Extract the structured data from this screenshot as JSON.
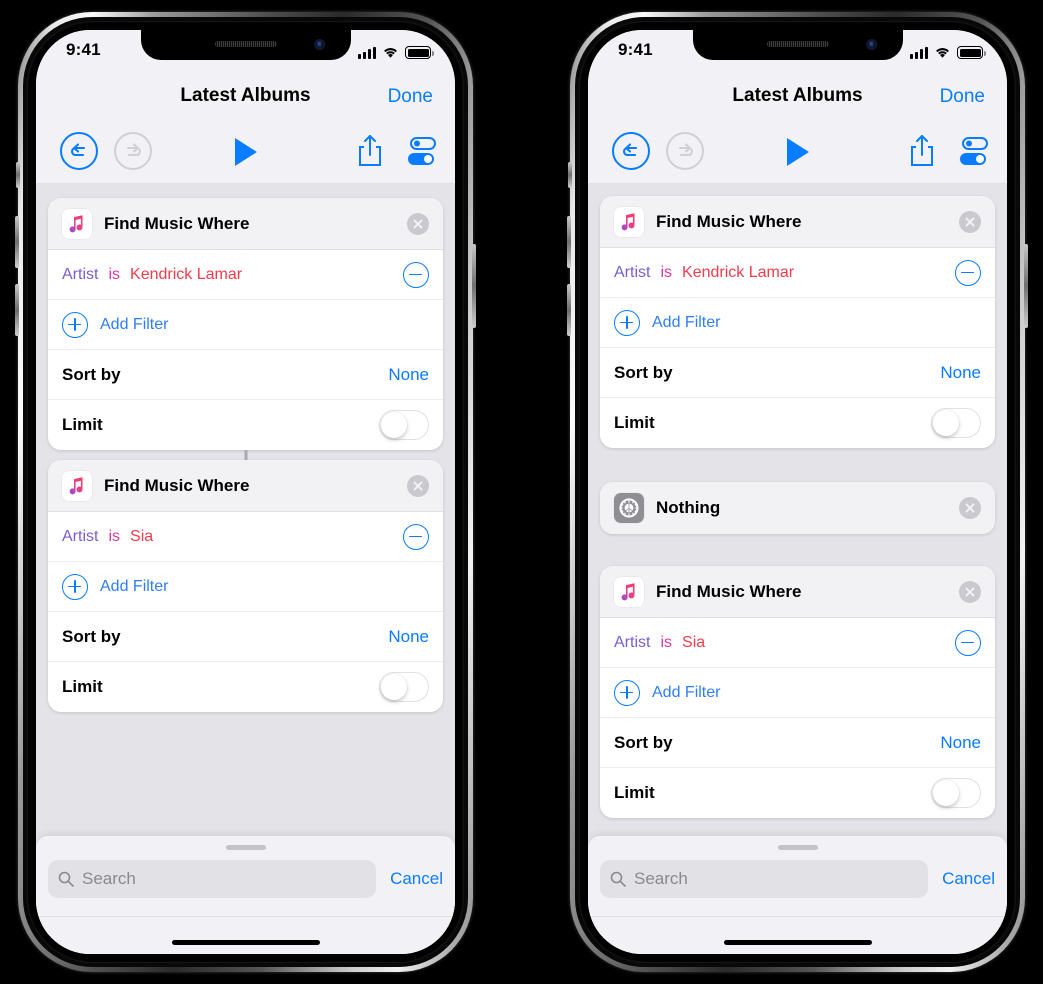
{
  "statusbar": {
    "time": "9:41",
    "signal_icon": "cellular-bars-icon",
    "wifi_icon": "wifi-icon",
    "battery_icon": "battery-full-icon"
  },
  "navbar": {
    "title": "Latest Albums",
    "done_label": "Done"
  },
  "toolbar": {
    "undo_icon": "undo-icon",
    "redo_icon": "redo-icon",
    "play_icon": "play-icon",
    "share_icon": "share-icon",
    "settings_icon": "settings-toggles-icon",
    "accent": "#0a7cff",
    "disabled": "#d0d0d4"
  },
  "labels": {
    "find_music_where": "Find Music Where",
    "nothing": "Nothing",
    "add_filter": "Add Filter",
    "sort_by": "Sort by",
    "sort_value": "None",
    "limit": "Limit",
    "filter_key": "Artist",
    "filter_op": "is",
    "artist_kendrick": "Kendrick Lamar",
    "artist_sia": "Sia"
  },
  "colors": {
    "key": "#7a5cd6",
    "op": "#e0379b",
    "value": "#f03b4c",
    "blue": "#0a7cff",
    "card_bg": "#ffffff",
    "card_head_bg": "#f2f2f5",
    "canvas": "#e3e3e8",
    "chrome": "#f2f2f6",
    "gear_tile": "#8e8e93"
  },
  "search": {
    "placeholder": "Search",
    "cancel_label": "Cancel",
    "icon": "search-icon"
  },
  "phones": [
    {
      "name": "left-phone",
      "cards": [
        {
          "type": "music",
          "icon": "apple-music-icon",
          "title": "Find Music Where",
          "artist": "Kendrick Lamar",
          "sort": "None",
          "limit_on": false,
          "connected_below": true
        },
        {
          "type": "music",
          "icon": "apple-music-icon",
          "title": "Find Music Where",
          "artist": "Sia",
          "sort": "None",
          "limit_on": false,
          "connected_below": false
        }
      ]
    },
    {
      "name": "right-phone",
      "cards": [
        {
          "type": "music",
          "icon": "apple-music-icon",
          "title": "Find Music Where",
          "artist": "Kendrick Lamar",
          "sort": "None",
          "limit_on": false,
          "connected_below": false
        },
        {
          "type": "nothing",
          "icon": "gear-icon",
          "title": "Nothing"
        },
        {
          "type": "music",
          "icon": "apple-music-icon",
          "title": "Find Music Where",
          "artist": "Sia",
          "sort": "None",
          "limit_on": false,
          "connected_below": false
        }
      ]
    }
  ]
}
